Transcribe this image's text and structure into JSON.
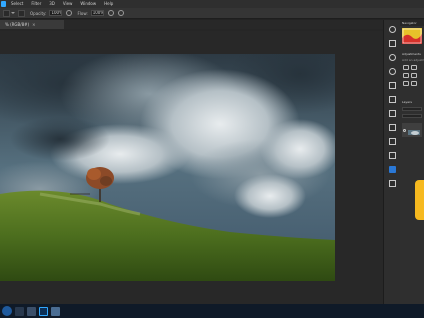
{
  "menu": {
    "items": [
      "Select",
      "Filter",
      "3D",
      "View",
      "Window",
      "Help"
    ]
  },
  "options_bar": {
    "opacity_label": "Opacity:",
    "opacity_value": "100%",
    "flow_label": "Flow:",
    "flow_value": "100%"
  },
  "document": {
    "tab_label": "% (RGB/8#)",
    "close_symbol": "×"
  },
  "panels": {
    "navigator_label": "Navigator",
    "adjustments_label": "Adjustments",
    "adjustments_sub": "Add an adjustment",
    "layers_label": "Layers"
  },
  "icons": {
    "app": "photoshop-icon",
    "tools": [
      "history-icon",
      "brush-icon",
      "info-icon",
      "color-icon",
      "layers-icon",
      "paragraph-icon",
      "character-icon",
      "play-icon",
      "channels-icon",
      "paths-icon",
      "properties-icon",
      "adjustments-icon"
    ]
  },
  "colors": {
    "accent": "#31a8ff",
    "side_tab": "#f6b91f",
    "taskbar": "#0f1a28"
  }
}
